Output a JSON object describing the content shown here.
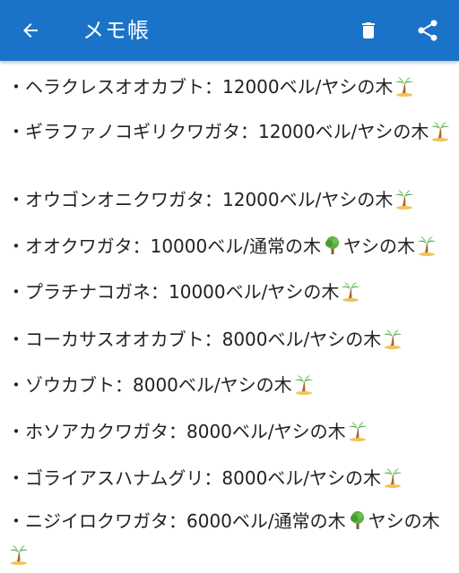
{
  "appbar": {
    "title": "メモ帳",
    "back_icon": "arrow-back-icon",
    "delete_icon": "trash-icon",
    "share_icon": "share-icon",
    "background_color": "#1a73c8"
  },
  "entries": [
    {
      "text": "・ヘラクレスオオカブト：12000ベル/ヤシの木",
      "trees": [
        "palm"
      ]
    },
    {
      "text": "・ギラファノコギリクワガタ：12000ベル/ヤシの木",
      "trees": [
        "palm"
      ]
    },
    {
      "text": "・オウゴンオニクワガタ：12000ベル/ヤシの木",
      "trees": [
        "palm"
      ]
    },
    {
      "text_part1": "・オオクワガタ：10000ベル/通常の木",
      "text_part2": "ヤシの木",
      "trees": [
        "broadleaf",
        "palm"
      ]
    },
    {
      "text": "・プラチナコガネ：10000ベル/ヤシの木",
      "trees": [
        "palm"
      ]
    },
    {
      "text": "・コーカサスオオカブト：8000ベル/ヤシの木",
      "trees": [
        "palm"
      ]
    },
    {
      "text": "・ゾウカブト：8000ベル/ヤシの木",
      "trees": [
        "palm"
      ]
    },
    {
      "text": "・ホソアカクワガタ：8000ベル/ヤシの木",
      "trees": [
        "palm"
      ]
    },
    {
      "text": "・ゴライアスハナムグリ：8000ベル/ヤシの木",
      "trees": [
        "palm"
      ]
    },
    {
      "text_part1": "・ニジイロクワガタ：6000ベル/通常の木",
      "text_part2": "ヤシの木",
      "trees": [
        "broadleaf",
        "palm"
      ]
    }
  ]
}
